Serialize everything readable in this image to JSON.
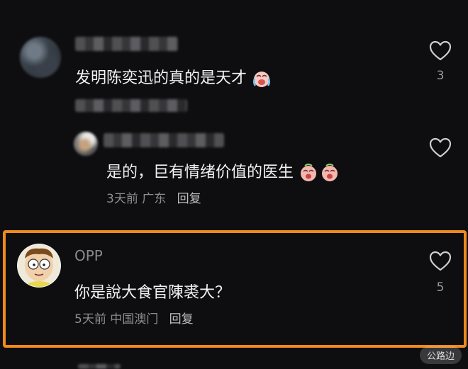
{
  "comments": [
    {
      "text": "发明陈奕迅的真的是天才",
      "emoji": "crying-laughing-face-icon",
      "likes": "3"
    },
    {
      "text": "是的，巨有情绪价值的医生",
      "emoji": "laughing-crying-face-icon",
      "meta_time": "3天前",
      "meta_location": "广东",
      "reply_label": "回复"
    },
    {
      "username": "OPP",
      "text": "你是說大食官陳裘大？",
      "likes": "5",
      "meta_time": "5天前",
      "meta_location": "中国澳门",
      "reply_label": "回复"
    }
  ],
  "watermark": "公路边",
  "colors": {
    "background": "#0e0e10",
    "highlight_border": "#f08a1c"
  }
}
